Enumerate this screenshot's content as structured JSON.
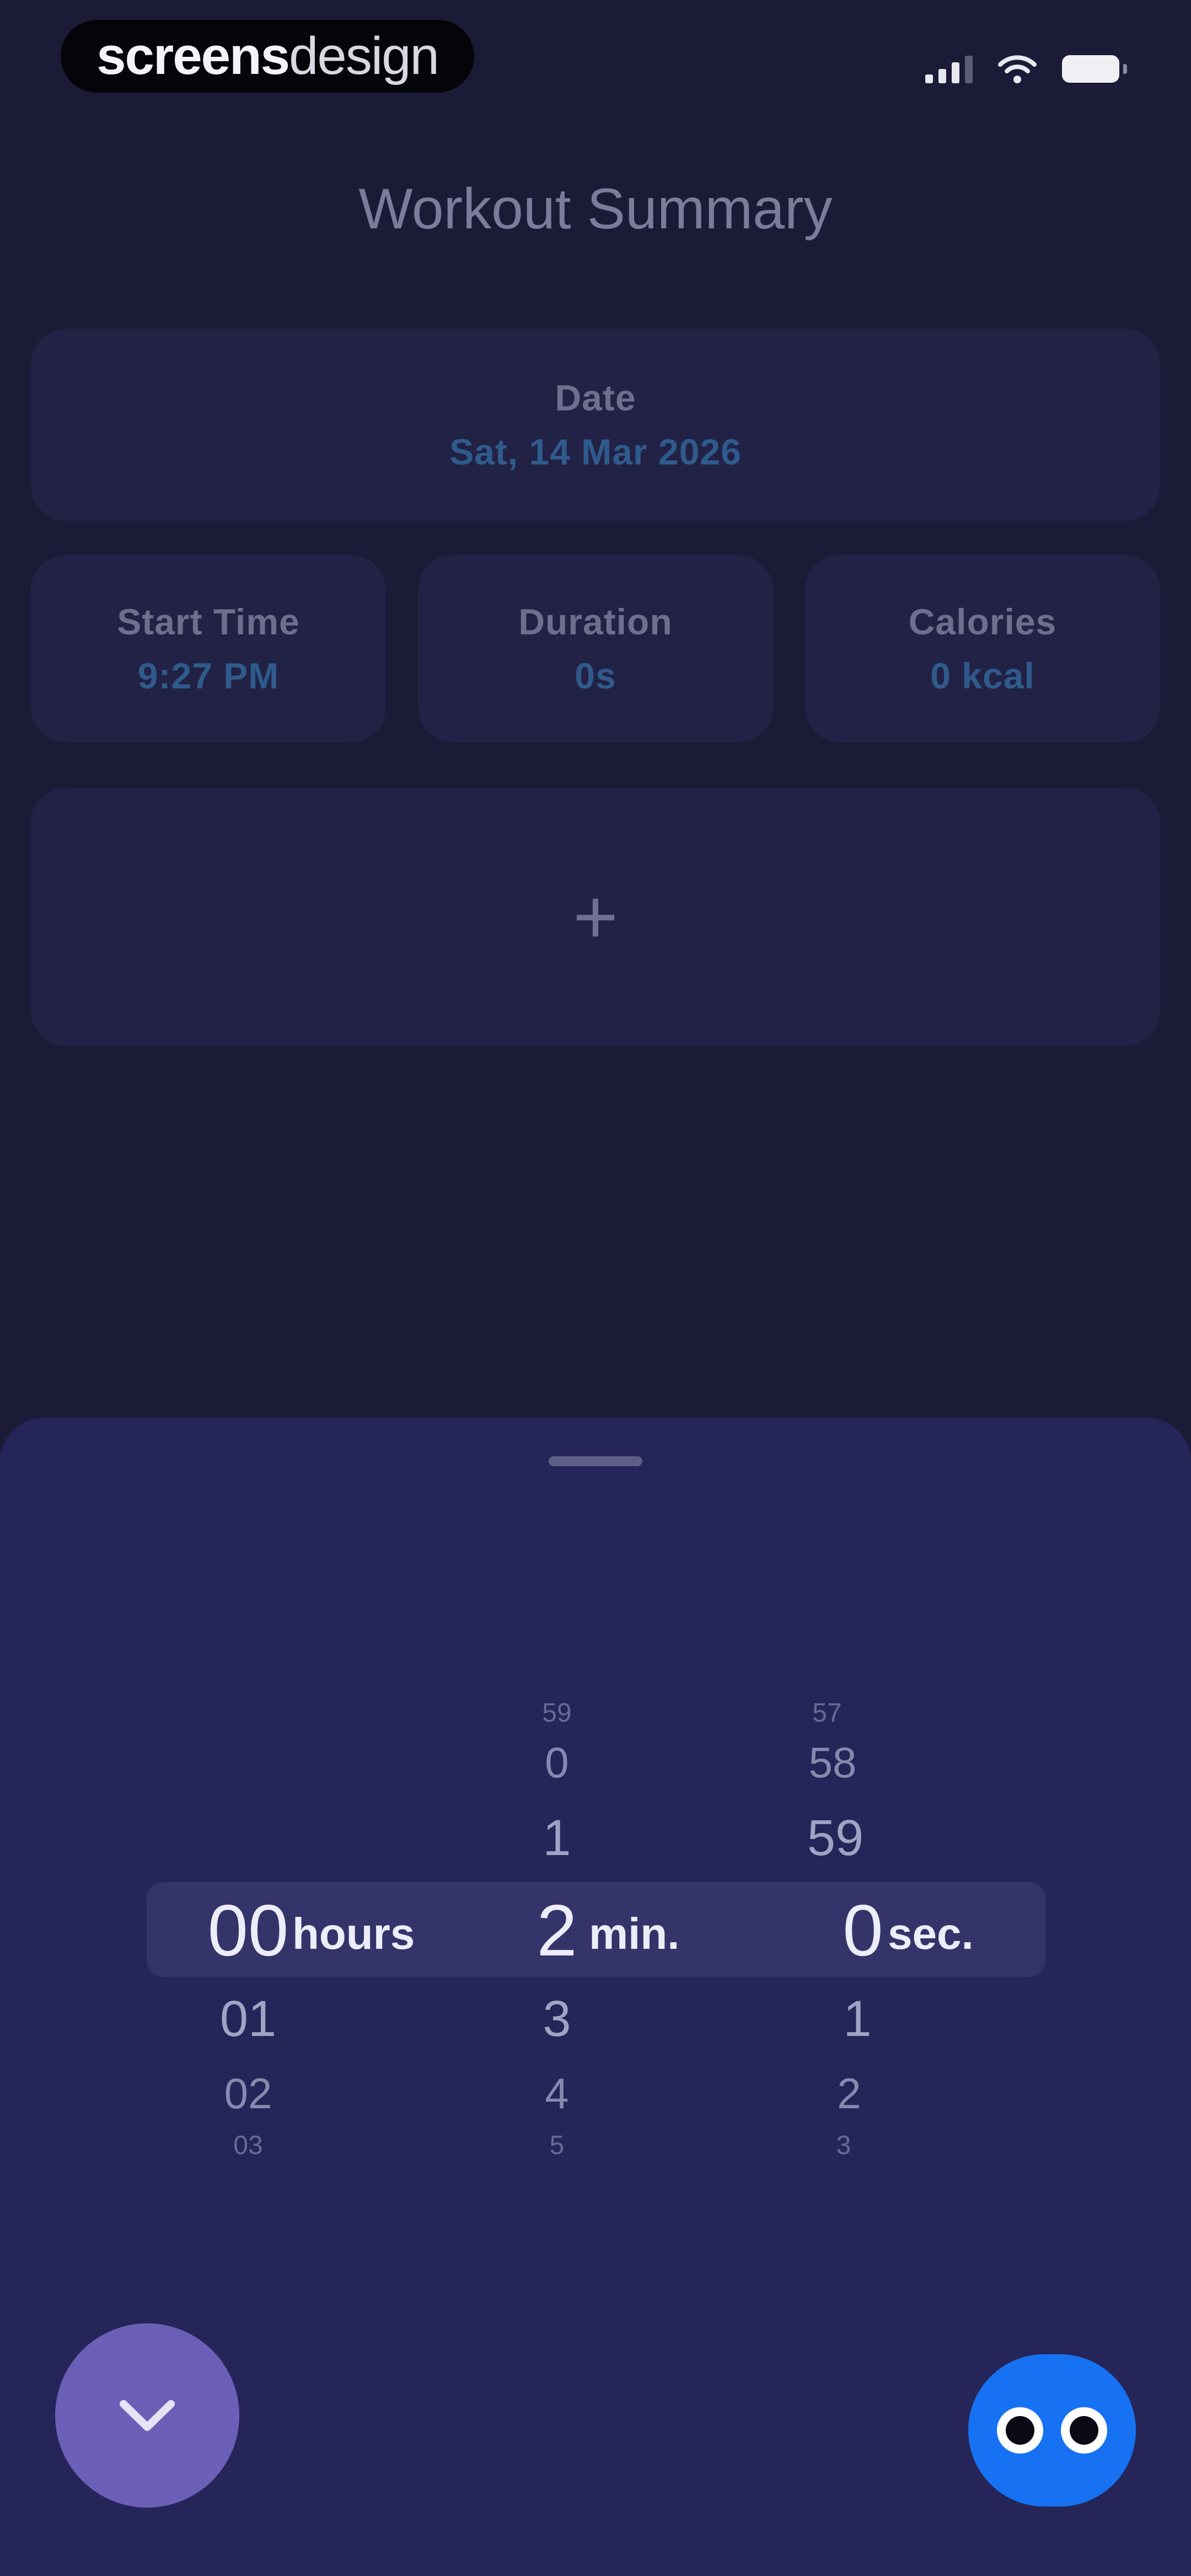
{
  "brand": {
    "part1": "screens",
    "part2": "design"
  },
  "header": {
    "title": "Workout Summary"
  },
  "date_card": {
    "label": "Date",
    "value": "Sat, 14 Mar 2026"
  },
  "stats": [
    {
      "label": "Start Time",
      "value": "9:27 PM"
    },
    {
      "label": "Duration",
      "value": "0s"
    },
    {
      "label": "Calories",
      "value": "0 kcal"
    }
  ],
  "add_card": {
    "symbol": "+"
  },
  "picker": {
    "hours": {
      "selected": "00",
      "below": [
        "01",
        "02",
        "03"
      ],
      "unit": "hours"
    },
    "minutes": {
      "above": [
        "59",
        "0",
        "1"
      ],
      "selected": "2",
      "below": [
        "3",
        "4",
        "5"
      ],
      "unit": "min."
    },
    "seconds": {
      "above": [
        "57",
        "58",
        "59"
      ],
      "selected": "0",
      "below": [
        "1",
        "2",
        "3"
      ],
      "unit": "sec."
    }
  },
  "icons": {
    "signal": "cellular-signal-icon",
    "wifi": "wifi-icon",
    "battery": "battery-icon",
    "collapse": "chevron-down-icon",
    "assistant": "assistant-eyes-icon"
  },
  "colors": {
    "background": "#1b1a37",
    "card": "#222246",
    "sheet": "#262559",
    "accent_value": "#2f5b8c",
    "collapse_button": "#6b5fb8",
    "assistant": "#1672f2"
  }
}
